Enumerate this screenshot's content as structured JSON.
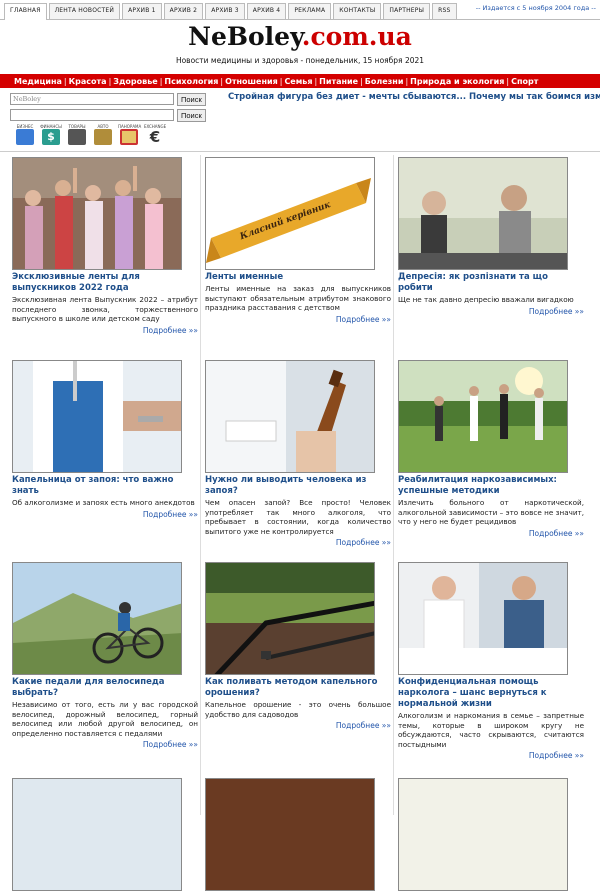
{
  "topbar": {
    "tabs": [
      "ГЛАВНАЯ",
      "ЛЕНТА НОВОСТЕЙ",
      "АРХИВ 1",
      "АРХИВ 2",
      "АРХИВ 3",
      "АРХИВ 4",
      "РЕКЛАМА",
      "КОНТАКТЫ",
      "ПАРТНЕРЫ",
      "RSS"
    ],
    "since": "-- Издается с 5 ноября 2004 года --"
  },
  "header": {
    "logo_part1": "NeBoley",
    "logo_part2": ".com.ua",
    "tagline": "Новости медицины и здоровья - понедельник, 15 ноября 2021"
  },
  "menu": [
    "Медицина",
    "Красота",
    "Здоровье",
    "Психология",
    "Отношения",
    "Семья",
    "Питание",
    "Болезни",
    "Природа и экология",
    "Спорт"
  ],
  "search": {
    "value1": "NeBoley",
    "value2": "",
    "button": "Поиск"
  },
  "promo": "Стройная фигура без диет - мечты сбываются... Почему мы так боимся измен?",
  "icons": [
    {
      "label": "БИЗНЕС",
      "name": "business-icon",
      "color": "#3a7bd5"
    },
    {
      "label": "ФИНАНСЫ",
      "name": "finance-icon",
      "color": "#2a9d8f"
    },
    {
      "label": "ТОВАРЫ",
      "name": "goods-icon",
      "color": "#555555"
    },
    {
      "label": "АВТО",
      "name": "auto-icon",
      "color": "#b08d3a"
    },
    {
      "label": "ПАНОРАМА",
      "name": "panorama-icon",
      "color": "#cc3333"
    },
    {
      "label": "EXCHANGE",
      "name": "exchange-icon",
      "color": "#333333"
    }
  ],
  "more_label": "Подробнее »»",
  "cards": [
    {
      "title": "Эксклюзивные ленты для выпускников 2022 года",
      "desc": "Эксклюзивная лента Выпускник 2022 – атрибут последнего звонка, торжественного выпускного в школе или детском саду"
    },
    {
      "title": "Ленты именные",
      "desc": "Ленты именные на заказ для выпускников выступают обязательным атрибутом знакового праздника расставания с детством",
      "ribbon": "Класний керівник"
    },
    {
      "title": "Депресія: як розпізнати та що робити",
      "desc": "Ще не так давно депресію вважали вигадкою"
    },
    {
      "title": "Капельница от запоя: что важно знать",
      "desc": "Об алкоголизме и запоях есть много анекдотов"
    },
    {
      "title": "Нужно ли выводить человека из запоя?",
      "desc": "Чем опасен запой? Все просто! Человек употребляет так много алкоголя, что пребывает в состоянии, когда количество выпитого уже не контролируется"
    },
    {
      "title": "Реабилитация наркозависимых: успешные методики",
      "desc": "Излечить больного от наркотической, алкогольной зависимости – это вовсе не значит, что у него не будет рецидивов"
    },
    {
      "title": "Какие педали для велосипеда выбрать?",
      "desc": "Независимо от того, есть ли у вас городской велосипед, дорожный велосипед, горный велосипед или любой другой велосипед, он определенно поставляется с педалями"
    },
    {
      "title": "Как поливать методом капельного орошения?",
      "desc": "Капельное орошение - это очень большое удобство для садоводов"
    },
    {
      "title": "Конфиденциальная помощь нарколога – шанс вернуться к нормальной жизни",
      "desc": "Алкоголизм и наркомания в семье – запретные темы, которые в широком кругу не обсуждаются, часто скрываются, считаются постыдными"
    }
  ]
}
